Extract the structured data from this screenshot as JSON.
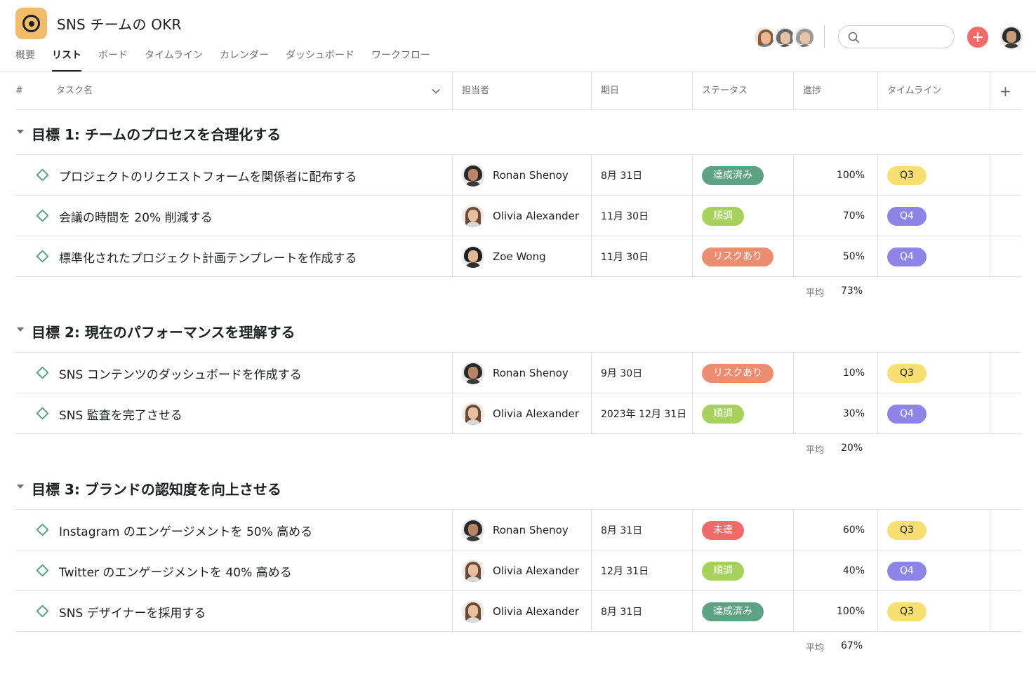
{
  "project": {
    "title": "SNS チームの OKR",
    "icon": "target-icon",
    "icon_color": "#f1bd6c"
  },
  "tabs": [
    {
      "label": "概要"
    },
    {
      "label": "リスト",
      "active": true
    },
    {
      "label": "ボード"
    },
    {
      "label": "タイムライン"
    },
    {
      "label": "カレンダー"
    },
    {
      "label": "ダッシュボード"
    },
    {
      "label": "ワークフロー"
    }
  ],
  "search": {
    "placeholder": "",
    "icon": "search-icon"
  },
  "add_button": {
    "icon": "plus-icon",
    "color": "#f06a6a"
  },
  "columns": {
    "num": "#",
    "task": "タスク名",
    "assignee": "担当者",
    "due": "期日",
    "status": "ステータス",
    "progress": "進捗",
    "timeline": "タイムライン",
    "add": "+"
  },
  "avg_label": "平均",
  "status_colors": {
    "達成済み": "#5da283",
    "順調": "#a6d15b",
    "リスクあり": "#ec8d71",
    "未達": "#f06a6a"
  },
  "quarter_colors": {
    "Q3": {
      "bg": "#f8df72",
      "fg": "#1e1f21"
    },
    "Q4": {
      "bg": "#8d84e8",
      "fg": "#ffffff"
    }
  },
  "sections": [
    {
      "title": "目標 1: チームのプロセスを合理化する",
      "average": "73%",
      "tasks": [
        {
          "name": "プロジェクトのリクエストフォームを関係者に配布する",
          "assignee": "Ronan Shenoy",
          "due": "8月 31日",
          "status": "達成済み",
          "progress": "100%",
          "timeline": "Q3"
        },
        {
          "name": "会議の時間を 20% 削減する",
          "assignee": "Olivia Alexander",
          "due": "11月 30日",
          "status": "順調",
          "progress": "70%",
          "timeline": "Q4"
        },
        {
          "name": "標準化されたプロジェクト計画テンプレートを作成する",
          "assignee": "Zoe Wong",
          "due": "11月 30日",
          "status": "リスクあり",
          "progress": "50%",
          "timeline": "Q4"
        }
      ]
    },
    {
      "title": "目標 2: 現在のパフォーマンスを理解する",
      "average": "20%",
      "tasks": [
        {
          "name": "SNS コンテンツのダッシュボードを作成する",
          "assignee": "Ronan Shenoy",
          "due": "9月 30日",
          "status": "リスクあり",
          "progress": "10%",
          "timeline": "Q3"
        },
        {
          "name": "SNS 監査を完了させる",
          "assignee": "Olivia Alexander",
          "due": "2023年 12月 31日",
          "status": "順調",
          "progress": "30%",
          "timeline": "Q4"
        }
      ]
    },
    {
      "title": "目標 3: ブランドの認知度を向上させる",
      "average": "67%",
      "tasks": [
        {
          "name": "Instagram のエンゲージメントを 50% 高める",
          "assignee": "Ronan Shenoy",
          "due": "8月 31日",
          "status": "未達",
          "progress": "60%",
          "timeline": "Q3"
        },
        {
          "name": "Twitter のエンゲージメントを 40% 高める",
          "assignee": "Olivia Alexander",
          "due": "12月 31日",
          "status": "順調",
          "progress": "40%",
          "timeline": "Q4"
        },
        {
          "name": "SNS デザイナーを採用する",
          "assignee": "Olivia Alexander",
          "due": "8月 31日",
          "status": "達成済み",
          "progress": "100%",
          "timeline": "Q3"
        }
      ]
    }
  ]
}
